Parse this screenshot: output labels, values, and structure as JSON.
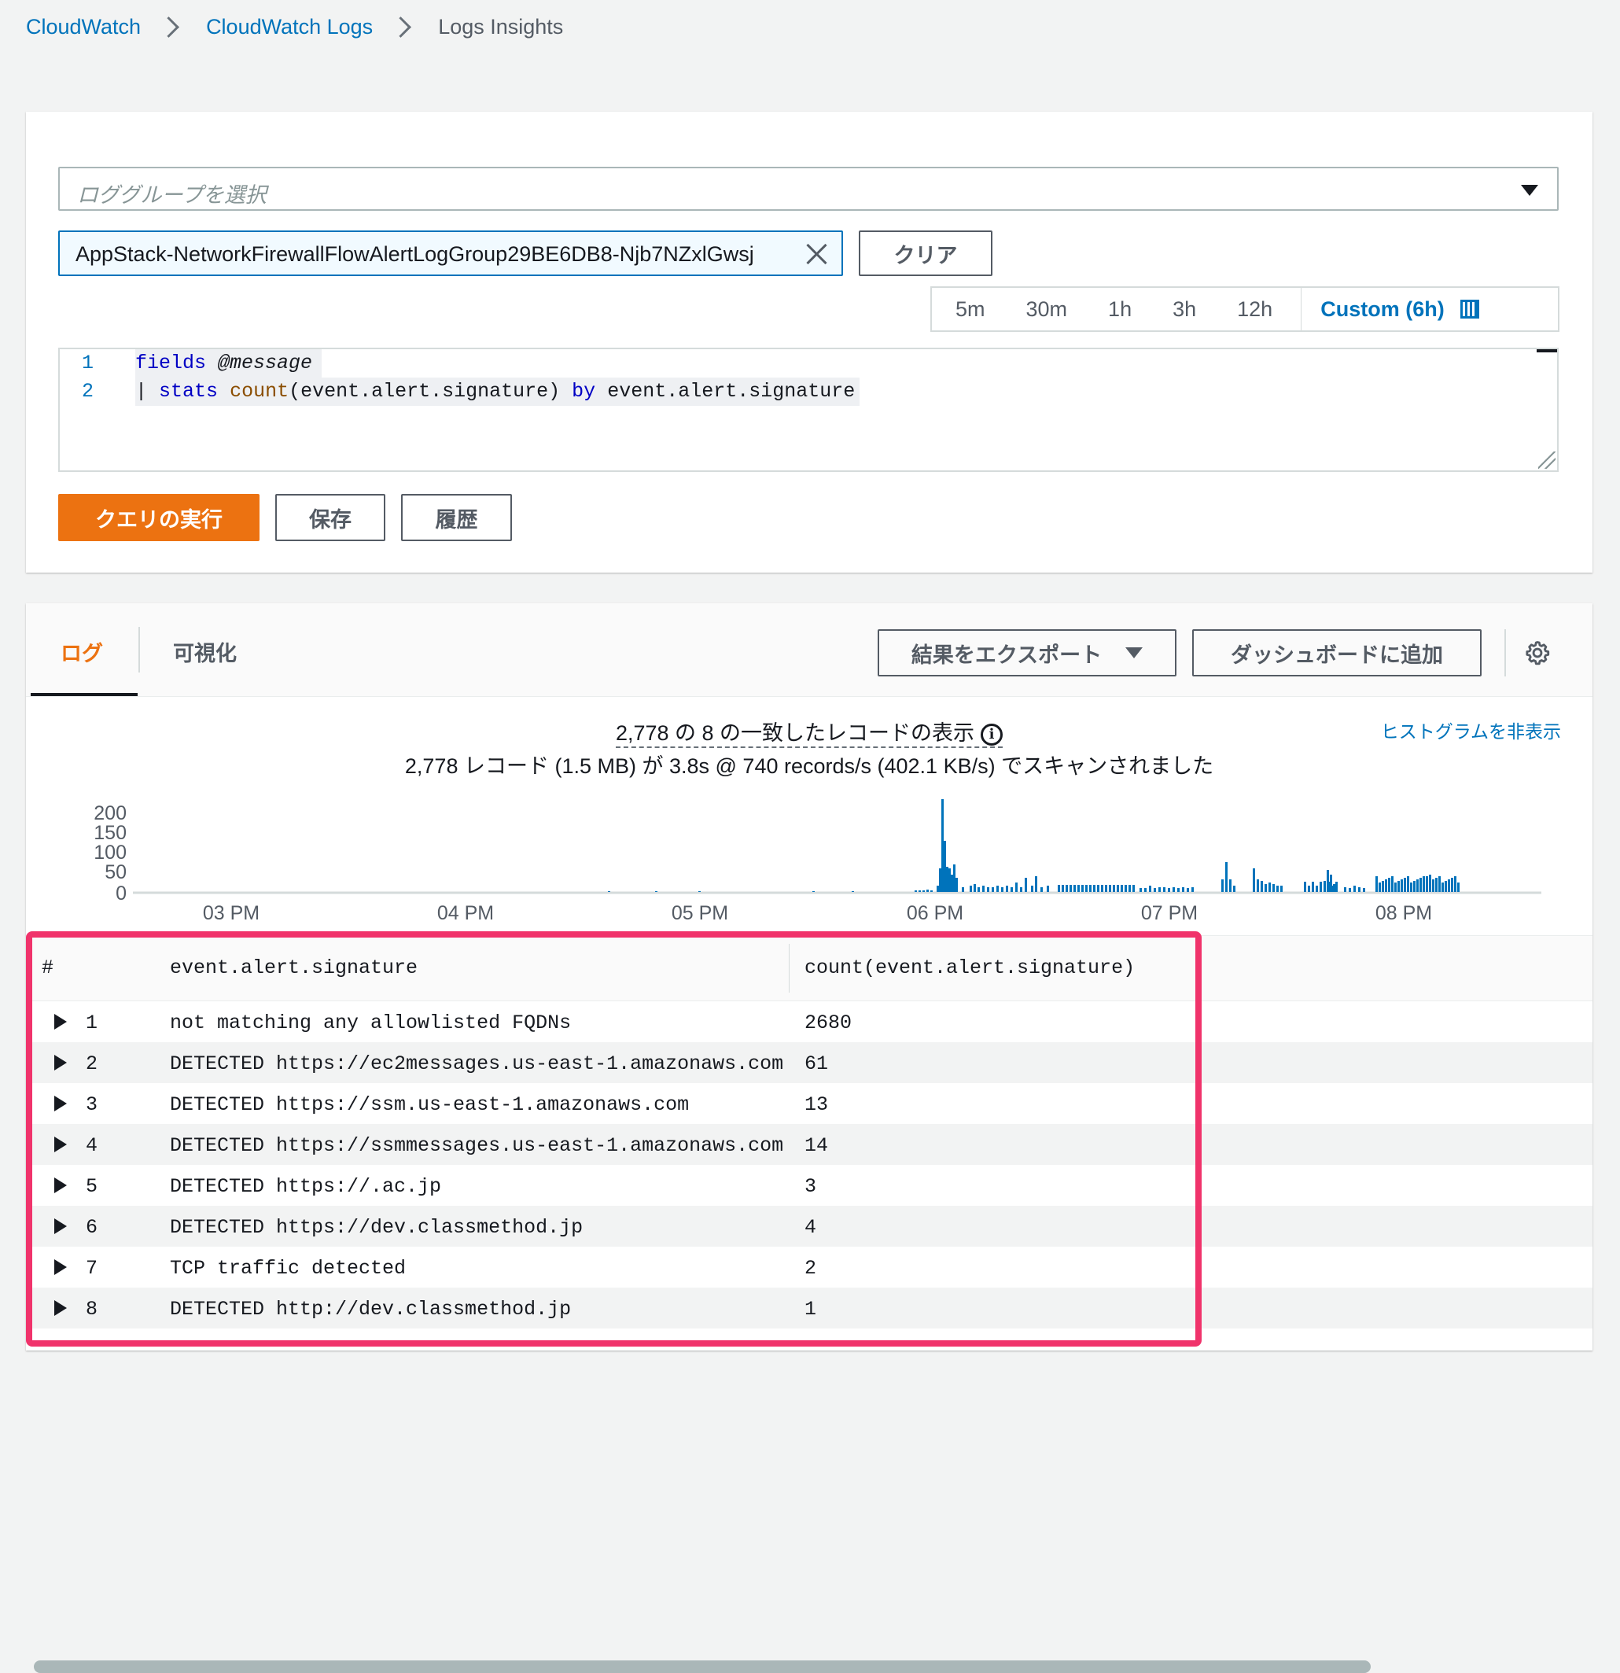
{
  "breadcrumb": {
    "items": [
      "CloudWatch",
      "CloudWatch Logs",
      "Logs Insights"
    ]
  },
  "query": {
    "log_group_placeholder": "ロググループを選択",
    "selected_log_group": "AppStack-NetworkFirewallFlowAlertLogGroup29BE6DB8-Njb7NZxlGwsj",
    "clear_label": "クリア",
    "time_ranges": [
      "5m",
      "30m",
      "1h",
      "3h",
      "12h"
    ],
    "custom_range_label": "Custom (6h)",
    "editor": {
      "line_numbers": [
        "1",
        "2"
      ],
      "line1": {
        "kw": "fields",
        "arg": "@message"
      },
      "line2": {
        "pipe": "|",
        "kw1": "stats",
        "fn": "count",
        "arg1": "(event.alert.signature)",
        "kw2": "by",
        "arg2": "event.alert.signature"
      }
    },
    "run_label": "クエリの実行",
    "save_label": "保存",
    "history_label": "履歴"
  },
  "results": {
    "tabs": [
      "ログ",
      "可視化"
    ],
    "export_label": "結果をエクスポート",
    "dashboard_label": "ダッシュボードに追加",
    "summary_line1": "2,778 の 8 の一致したレコードの表示",
    "summary_line2": "2,778 レコード (1.5 MB) が 3.8s @ 740 records/s (402.1 KB/s) でスキャンされました",
    "hide_histogram_label": "ヒストグラムを非表示",
    "histogram": {
      "y_ticks": [
        "200",
        "150",
        "100",
        "50",
        "0"
      ],
      "x_ticks": [
        "03 PM",
        "04 PM",
        "05 PM",
        "06 PM",
        "07 PM",
        "08 PM"
      ],
      "bar_color": "#0073bb"
    },
    "table": {
      "columns": [
        "#",
        "event.alert.signature",
        "count(event.alert.signature)"
      ],
      "rows": [
        {
          "n": "1",
          "sig": "not matching any allowlisted FQDNs",
          "count": "2680"
        },
        {
          "n": "2",
          "sig": "DETECTED https://ec2messages.us-east-1.amazonaws.com",
          "count": "61"
        },
        {
          "n": "3",
          "sig": "DETECTED https://ssm.us-east-1.amazonaws.com",
          "count": "13"
        },
        {
          "n": "4",
          "sig": "DETECTED https://ssmmessages.us-east-1.amazonaws.com",
          "count": "14"
        },
        {
          "n": "5",
          "sig": "DETECTED https://.ac.jp",
          "count": "3"
        },
        {
          "n": "6",
          "sig": "DETECTED https://dev.classmethod.jp",
          "count": "4"
        },
        {
          "n": "7",
          "sig": "TCP traffic detected",
          "count": "2"
        },
        {
          "n": "8",
          "sig": "DETECTED http://dev.classmethod.jp",
          "count": "1"
        }
      ]
    }
  },
  "colors": {
    "accent_orange": "#ec7211",
    "link_blue": "#0073bb",
    "highlight_pink": "#f0336b"
  }
}
